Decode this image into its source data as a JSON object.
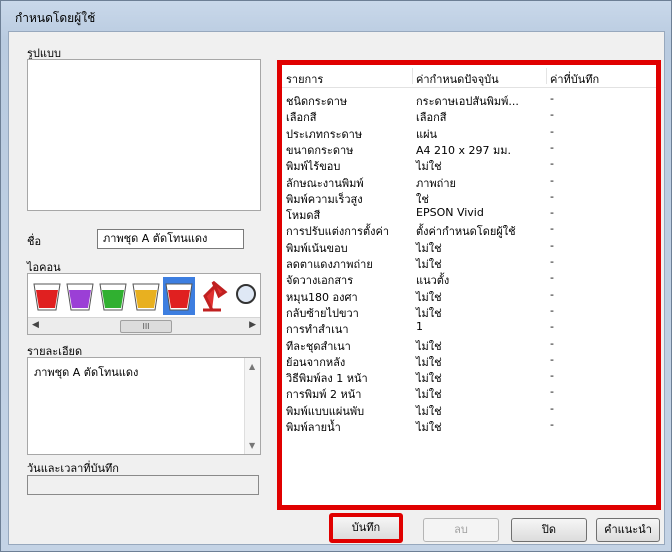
{
  "window": {
    "title": "กำหนดโดยผู้ใช้"
  },
  "left": {
    "format_label": "รูปแบบ",
    "name_label": "ชื่อ",
    "name_value": "ภาพชุด A ตัดโทนแดง",
    "icon_label": "ไอคอน",
    "icons": [
      "red-cup-icon",
      "purple-cup-icon",
      "green-cup-icon",
      "yellow-cup-icon",
      "red-cup-selected-icon",
      "desk-lamp-icon",
      "magnifier-icon"
    ],
    "scroll_thumb": "III",
    "detail_label": "รายละเอียด",
    "detail_text": "ภาพชุด A ตัดโทนแดง",
    "datetime_label": "วันและเวลาที่บันทึก",
    "datetime_value": ""
  },
  "table": {
    "headers": [
      "รายการ",
      "ค่ากำหนดปัจจุบัน",
      "ค่าที่บันทึก"
    ],
    "rows": [
      [
        "ชนิดกระดาษ",
        "กระดาษเอปสันพิมพ์...",
        "-"
      ],
      [
        "เลือกสี",
        "เลือกสี",
        "-"
      ],
      [
        "ประเภทกระดาษ",
        "แผ่น",
        "-"
      ],
      [
        "ขนาดกระดาษ",
        "A4 210 x 297 มม.",
        "-"
      ],
      [
        "พิมพ์ไร้ขอบ",
        "ไม่ใช่",
        "-"
      ],
      [
        "ลักษณะงานพิมพ์",
        "ภาพถ่าย",
        "-"
      ],
      [
        "พิมพ์ความเร็วสูง",
        "ใช่",
        "-"
      ],
      [
        "โหมดสี",
        "EPSON Vivid",
        "-"
      ],
      [
        "การปรับแต่งการตั้งค่า",
        "ตั้งค่ากำหนดโดยผู้ใช้",
        "-"
      ],
      [
        "พิมพ์เน้นขอบ",
        "ไม่ใช่",
        "-"
      ],
      [
        "ลดตาแดงภาพถ่าย",
        "ไม่ใช่",
        "-"
      ],
      [
        "จัดวางเอกสาร",
        "แนวตั้ง",
        "-"
      ],
      [
        "หมุน180 องศา",
        "ไม่ใช่",
        "-"
      ],
      [
        "กลับซ้ายไปขวา",
        "ไม่ใช่",
        "-"
      ],
      [
        "การทำสำเนา",
        "1",
        "-"
      ],
      [
        "ทีละชุดสำเนา",
        "ไม่ใช่",
        "-"
      ],
      [
        "ย้อนจากหลัง",
        "ไม่ใช่",
        "-"
      ],
      [
        "วิธีพิมพ์ลง 1 หน้า",
        "ไม่ใช่",
        "-"
      ],
      [
        "การพิมพ์ 2 หน้า",
        "ไม่ใช่",
        "-"
      ],
      [
        "พิมพ์แบบแผ่นพับ",
        "ไม่ใช่",
        "-"
      ],
      [
        "พิมพ์ลายน้ำ",
        "ไม่ใช่",
        "-"
      ]
    ]
  },
  "buttons": {
    "save": "บันทึก",
    "delete": "ลบ",
    "close": "ปิด",
    "help": "คำแนะนำ"
  },
  "colors": {
    "highlight": "#e00000",
    "selection": "#3d7ee0"
  }
}
